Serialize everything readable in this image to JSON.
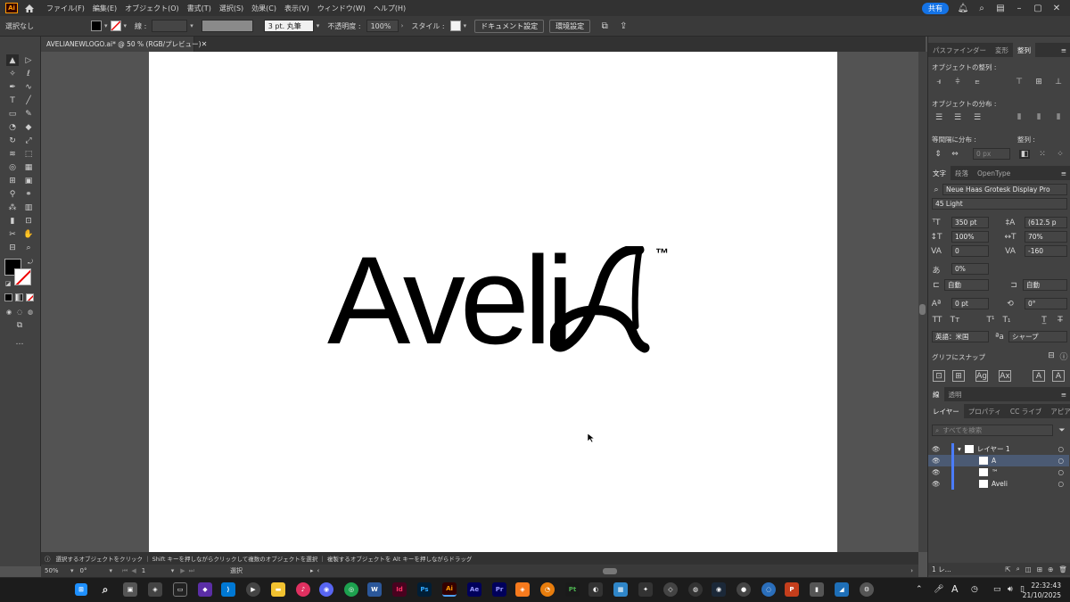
{
  "menubar": {
    "app_logo": "Ai",
    "items": [
      "ファイル(F)",
      "編集(E)",
      "オブジェクト(O)",
      "書式(T)",
      "選択(S)",
      "効果(C)",
      "表示(V)",
      "ウィンドウ(W)",
      "ヘルプ(H)"
    ],
    "share_label": "共有"
  },
  "controlbar": {
    "selection_label": "選択なし",
    "stroke_label": "線 :",
    "stroke_profile": "3 pt. 丸筆",
    "opacity_label": "不透明度 :",
    "opacity_value": "100%",
    "style_label": "スタイル :",
    "doc_settings": "ドキュメント設定",
    "prefs": "環境設定"
  },
  "document": {
    "tab_title": "AVELIANEWLOGO.ai* @ 50 % (RGB/プレビュー)",
    "logo_text": "Aveli",
    "logo_glyph": "A",
    "logo_tm": "™"
  },
  "statusbar": {
    "hint": "選択するオブジェクトをクリック ｜ Shift キーを押しながらクリックして複数のオブジェクトを選択 ｜ 複製するオブジェクトを Alt キーを押しながらドラッグ",
    "zoom": "50%",
    "rotation": "0°",
    "artboard_num": "1",
    "tool_name": "選択"
  },
  "panels": {
    "align_tabs": [
      "パスファインダー",
      "変形",
      "整列"
    ],
    "align_objects_label": "オブジェクトの整列 :",
    "distribute_objects_label": "オブジェクトの分布 :",
    "distribute_spacing_label": "等間隔に分布 :",
    "align_to_label": "整列 :",
    "spacing_value": "0 px",
    "char_tabs": [
      "文字",
      "段落",
      "OpenType"
    ],
    "font_family": "Neue Haas Grotesk Display Pro",
    "font_style": "45 Light",
    "font_size": "350 pt",
    "leading": "(612.5 p",
    "vscale": "100%",
    "hscale": "70%",
    "kerning": "0",
    "tracking": "-160",
    "tsume": "0%",
    "aki_left": "自動",
    "aki_right": "自動",
    "baseline": "0 pt",
    "rotate": "0°",
    "language": "英語：米国",
    "antialias": "シャープ",
    "glyph_snap_label": "グリフにスナップ",
    "stroke_tabs": [
      "線",
      "透明"
    ],
    "layer_tabs": [
      "レイヤー",
      "プロパティ",
      "CC ライブ",
      "アピアラン"
    ],
    "layer_search_placeholder": "すべてを検索",
    "layers": [
      {
        "name": "レイヤー 1",
        "level": 0,
        "selected": false
      },
      {
        "name": "A",
        "level": 1,
        "selected": true
      },
      {
        "name": "™",
        "level": 1,
        "selected": false
      },
      {
        "name": "Aveli",
        "level": 1,
        "selected": false
      }
    ],
    "layer_count": "1 レ..."
  },
  "taskbar": {
    "time": "22:32:43",
    "date": "21/10/2025",
    "ime": "A"
  }
}
